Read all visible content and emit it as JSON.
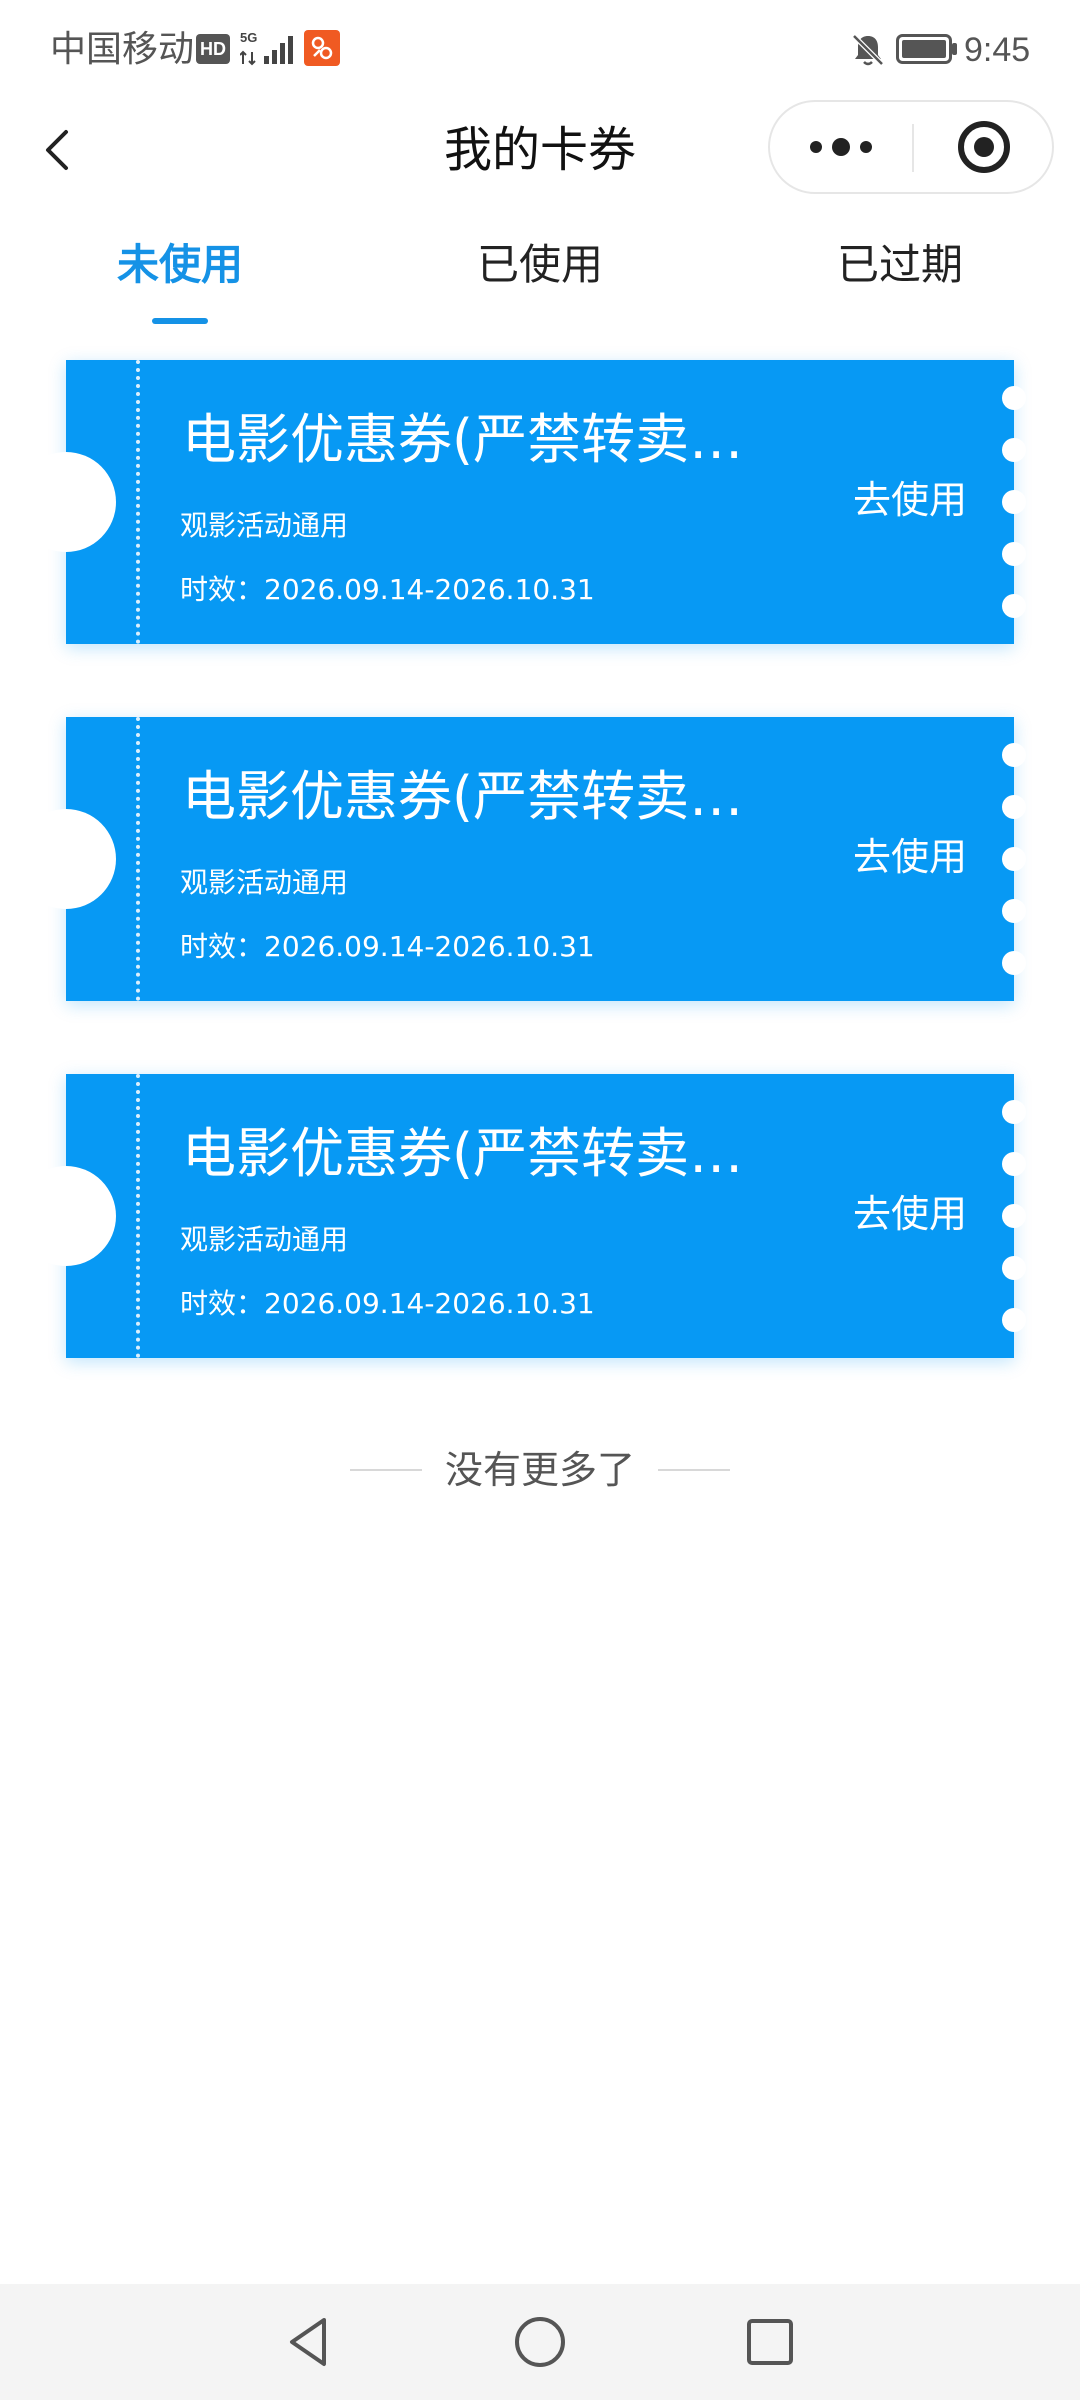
{
  "status_bar": {
    "carrier": "中国移动",
    "hd_badge": "HD",
    "network": "5G",
    "time": "9:45"
  },
  "nav": {
    "title": "我的卡券",
    "icons": {
      "back": "chevron-left-icon",
      "more": "more-dots-icon",
      "close": "target-circle-icon"
    }
  },
  "tabs": [
    {
      "label": "未使用",
      "active": true
    },
    {
      "label": "已使用",
      "active": false
    },
    {
      "label": "已过期",
      "active": false
    }
  ],
  "coupons": [
    {
      "title": "电影优惠券(严禁转卖…",
      "subtitle": "观影活动通用",
      "validity": "时效：2026.09.14-2026.10.31",
      "action": "去使用"
    },
    {
      "title": "电影优惠券(严禁转卖…",
      "subtitle": "观影活动通用",
      "validity": "时效：2026.09.14-2026.10.31",
      "action": "去使用"
    },
    {
      "title": "电影优惠券(严禁转卖…",
      "subtitle": "观影活动通用",
      "validity": "时效：2026.09.14-2026.10.31",
      "action": "去使用"
    }
  ],
  "footer": {
    "no_more": "没有更多了"
  },
  "colors": {
    "accent": "#1592e6",
    "coupon_bg": "#0799f4"
  }
}
